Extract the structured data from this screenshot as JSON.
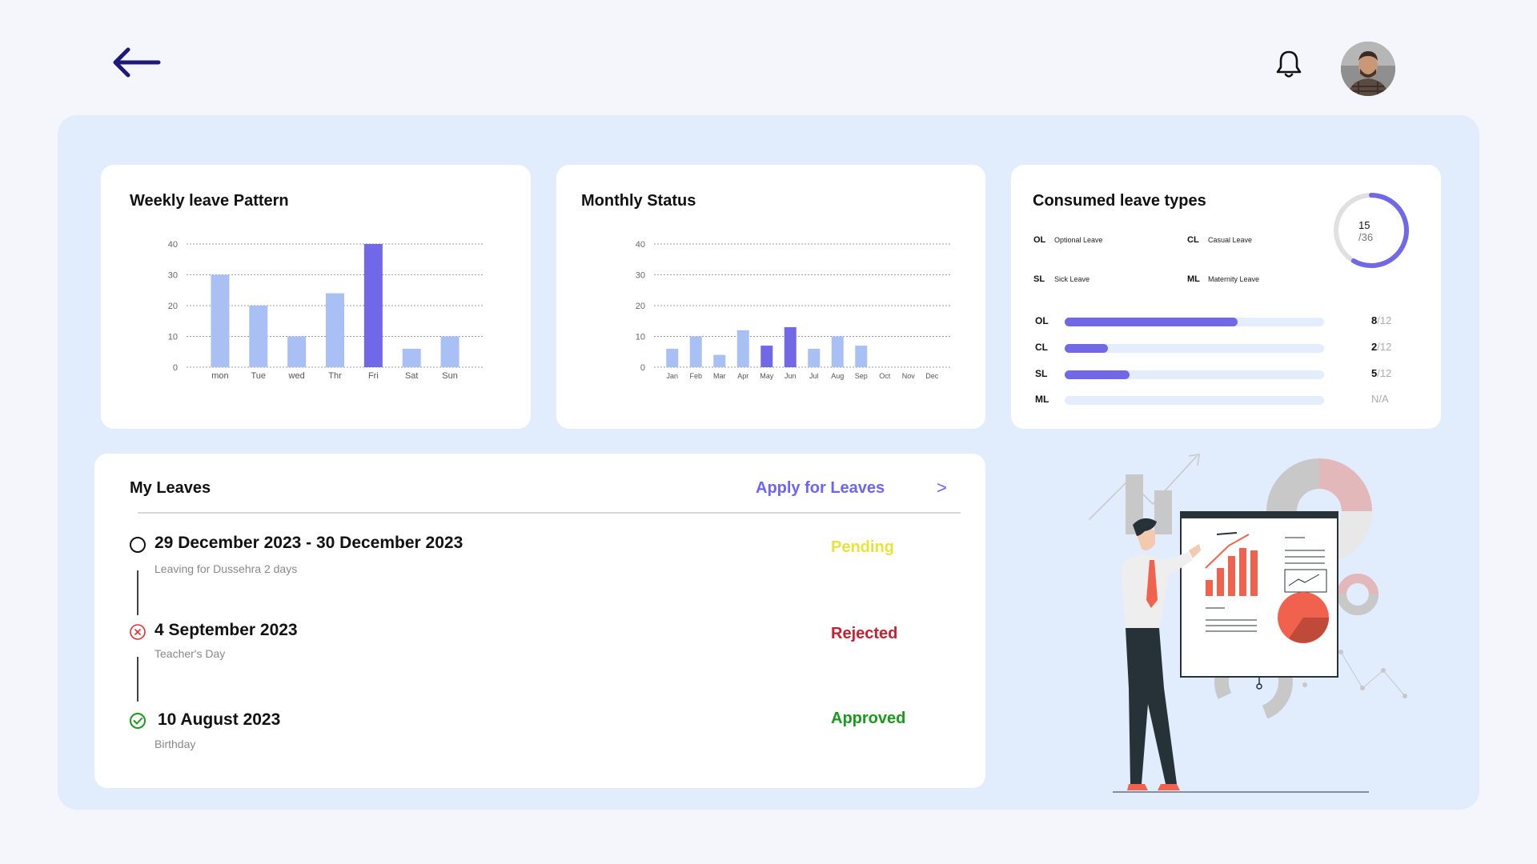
{
  "header": {
    "back_icon": "arrow-left-icon",
    "bell_icon": "bell-icon",
    "avatar_label": "user-avatar",
    "accent_color": "#1f1a7a"
  },
  "weekly": {
    "title": "Weekly leave Pattern",
    "chart_data": {
      "type": "bar",
      "categories": [
        "mon",
        "Tue",
        "wed",
        "Thr",
        "Fri",
        "Sat",
        "Sun"
      ],
      "values": [
        30,
        20,
        10,
        24,
        40,
        6,
        10
      ],
      "highlight_index": 4,
      "ylim": [
        0,
        40
      ],
      "yticks": [
        "40",
        "30",
        "20",
        "10",
        "0"
      ],
      "colors": {
        "normal": "#a9c0f5",
        "highlight": "#7068e6"
      }
    }
  },
  "monthly": {
    "title": "Monthly Status",
    "chart_data": {
      "type": "bar",
      "categories": [
        "Jan",
        "Feb",
        "Mar",
        "Apr",
        "May",
        "Jun",
        "Jul",
        "Aug",
        "Sep",
        "Oct",
        "Nov",
        "Dec"
      ],
      "values": [
        6,
        10,
        4,
        12,
        7,
        13,
        6,
        10,
        7,
        0,
        0,
        0
      ],
      "highlight_indices": [
        4,
        5
      ],
      "ylim": [
        0,
        40
      ],
      "yticks": [
        "40",
        "30",
        "20",
        "10",
        "0"
      ],
      "colors": {
        "normal": "#a9c0f5",
        "highlight": "#7068e6"
      }
    }
  },
  "consumed": {
    "title": "Consumed leave types",
    "ring": {
      "used": "15",
      "total": "/36",
      "fraction": 0.4167
    },
    "legend": [
      {
        "code": "OL",
        "name": "Optional Leave"
      },
      {
        "code": "CL",
        "name": "Casual Leave"
      },
      {
        "code": "SL",
        "name": "Sick Leave"
      },
      {
        "code": "ML",
        "name": "Maternity Leave"
      }
    ],
    "bars": [
      {
        "code": "OL",
        "used": "8",
        "total": "/12",
        "fraction": 0.6667
      },
      {
        "code": "CL",
        "used": "2",
        "total": "/12",
        "fraction": 0.1667
      },
      {
        "code": "SL",
        "used": "5",
        "total": "/12",
        "fraction": 0.25
      },
      {
        "code": "ML",
        "na": "N/A",
        "fraction": 0
      }
    ]
  },
  "leaves": {
    "title": "My Leaves",
    "apply_label": "Apply for Leaves",
    "apply_chevron": ">",
    "items": [
      {
        "date": "29 December 2023 - 30 December 2023",
        "sub": "Leaving for Dussehra  2 days",
        "status": "Pending",
        "status_color": "#e8e23a",
        "icon": "pending-circle-icon"
      },
      {
        "date": "4 September 2023",
        "sub": "Teacher's Day",
        "status": "Rejected",
        "status_color": "#c8202e",
        "icon": "rejected-x-icon"
      },
      {
        "date": "10 August 2023",
        "sub": "Birthday",
        "status": "Approved",
        "status_color": "#1a9a1a",
        "icon": "approved-check-icon"
      }
    ]
  }
}
